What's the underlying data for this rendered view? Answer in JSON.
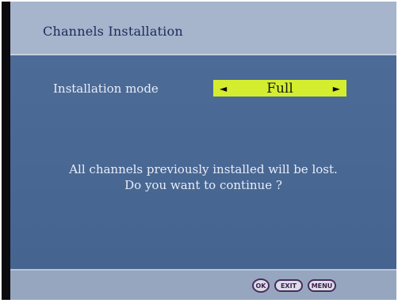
{
  "dialog": {
    "title": "Channels Installation"
  },
  "installation_mode": {
    "label": "Installation mode",
    "value": "Full",
    "left_arrow": "◄",
    "right_arrow": "►"
  },
  "message": {
    "line1": "All channels previously installed will be lost.",
    "line2": "Do you want to continue ?"
  },
  "footer": {
    "ok_label": "OK",
    "exit_label": "EXIT",
    "menu_label": "MENU"
  },
  "colors": {
    "header_bg": "#a6b4cc",
    "content_bg": "#4a6894",
    "selector_bg": "#d4ee2f",
    "footer_bg": "#97a6bf"
  }
}
